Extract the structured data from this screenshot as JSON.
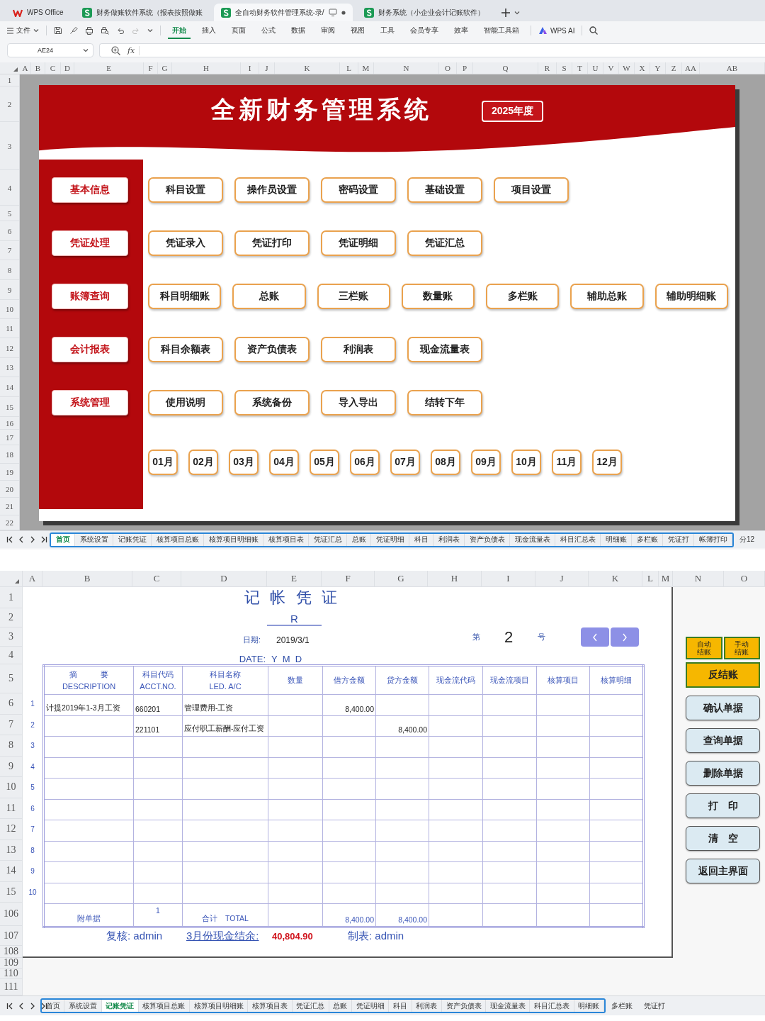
{
  "app_tabs": [
    {
      "kind": "home",
      "label": "WPS Office",
      "selected": false
    },
    {
      "kind": "sheet",
      "label": "财务做账软件系统（报表按照做账",
      "selected": false
    },
    {
      "kind": "sheet",
      "label": "全自动财务软件管理系统-录/",
      "selected": true
    },
    {
      "kind": "sheet",
      "label": "财务系统（小企业会计记账软件）",
      "selected": false
    }
  ],
  "file_menu": "文件",
  "ribbon_tabs": [
    {
      "label": "开始",
      "selected": true
    },
    {
      "label": "插入",
      "selected": false
    },
    {
      "label": "页面",
      "selected": false
    },
    {
      "label": "公式",
      "selected": false
    },
    {
      "label": "数据",
      "selected": false
    },
    {
      "label": "审阅",
      "selected": false
    },
    {
      "label": "视图",
      "selected": false
    },
    {
      "label": "工具",
      "selected": false
    },
    {
      "label": "会员专享",
      "selected": false
    },
    {
      "label": "效率",
      "selected": false
    },
    {
      "label": "智能工具箱",
      "selected": false
    }
  ],
  "ai_button": "WPS AI",
  "formula_bar": {
    "name_box": "AE24",
    "fx": "fx"
  },
  "sheet1": {
    "columns": [
      "A",
      "B",
      "C",
      "D",
      "E",
      "F",
      "G",
      "H",
      "I",
      "J",
      "K",
      "L",
      "M",
      "N",
      "O",
      "P",
      "Q",
      "R",
      "S",
      "T",
      "U",
      "V",
      "W",
      "X",
      "Y",
      "Z",
      "AA",
      "AB"
    ],
    "rows": [
      "1",
      "2",
      "3",
      "4",
      "5",
      "6",
      "7",
      "8",
      "9",
      "10",
      "11",
      "12",
      "13",
      "14",
      "15",
      "16",
      "17",
      "18",
      "19",
      "20",
      "21",
      "22"
    ],
    "dashboard": {
      "title": "全新财务管理系统",
      "year_badge": "2025年度",
      "sections": [
        {
          "category": "基本信息",
          "buttons": [
            "科目设置",
            "操作员设置",
            "密码设置",
            "基础设置",
            "项目设置"
          ]
        },
        {
          "category": "凭证处理",
          "buttons": [
            "凭证录入",
            "凭证打印",
            "凭证明细",
            "凭证汇总"
          ]
        },
        {
          "category": "账簿查询",
          "buttons": [
            "科目明细账",
            "总账",
            "三栏账",
            "数量账",
            "多栏账",
            "辅助总账",
            "辅助明细账"
          ]
        },
        {
          "category": "会计报表",
          "buttons": [
            "科目余额表",
            "资产负债表",
            "利润表",
            "现金流量表"
          ]
        },
        {
          "category": "系统管理",
          "buttons": [
            "使用说明",
            "系统备份",
            "导入导出",
            "结转下年"
          ]
        }
      ],
      "months": [
        "01月",
        "02月",
        "03月",
        "04月",
        "05月",
        "06月",
        "07月",
        "08月",
        "09月",
        "10月",
        "11月",
        "12月"
      ]
    },
    "sheet_tabs": [
      {
        "label": "首页",
        "selected": true
      },
      {
        "label": "系统设置",
        "selected": false
      },
      {
        "label": "记账凭证",
        "selected": false
      },
      {
        "label": "核算项目总账",
        "selected": false
      },
      {
        "label": "核算项目明细账",
        "selected": false
      },
      {
        "label": "核算项目表",
        "selected": false
      },
      {
        "label": "凭证汇总",
        "selected": false
      },
      {
        "label": "总账",
        "selected": false
      },
      {
        "label": "凭证明细",
        "selected": false
      },
      {
        "label": "科目",
        "selected": false
      },
      {
        "label": "利润表",
        "selected": false
      },
      {
        "label": "资产负债表",
        "selected": false
      },
      {
        "label": "现金流量表",
        "selected": false
      },
      {
        "label": "科目汇总表",
        "selected": false
      },
      {
        "label": "明细账",
        "selected": false
      },
      {
        "label": "多栏账",
        "selected": false
      },
      {
        "label": "凭证打",
        "selected": false
      },
      {
        "label": "帐簿打印",
        "selected": false
      }
    ],
    "more_tabs": [
      {
        "label": "分12",
        "selected": false
      }
    ]
  },
  "sheet2": {
    "columns": [
      "A",
      "B",
      "C",
      "D",
      "E",
      "F",
      "G",
      "H",
      "I",
      "J",
      "K",
      "L",
      "M",
      "N",
      "O"
    ],
    "rows": [
      "1",
      "2",
      "3",
      "4",
      "5",
      "6",
      "7",
      "8",
      "9",
      "10",
      "11",
      "12",
      "13",
      "14",
      "15",
      "106",
      "107",
      "108",
      "109",
      "110",
      "111"
    ],
    "voucher": {
      "title": "记 帐 凭 证",
      "subtitle": "R",
      "date_label": "日期:",
      "date": "2019/3/1",
      "date_label_en": "DATE:",
      "date_parts": "Y  M  D",
      "number_prefix": "第",
      "number": "2",
      "number_suffix": "号",
      "table": {
        "columns": [
          {
            "kind": "text",
            "label": "摘　　　要",
            "label_en": "DESCRIPTION"
          },
          {
            "kind": "code",
            "label": "科目代码",
            "label_en": "ACCT.NO."
          },
          {
            "kind": "text",
            "label": "科目名称",
            "label_en": "LED. A/C"
          },
          {
            "kind": "amount",
            "label": "数量"
          },
          {
            "kind": "amount",
            "label": "借方金额"
          },
          {
            "kind": "amount",
            "label": "贷方金额"
          },
          {
            "kind": "text",
            "label": "现金流代码"
          },
          {
            "kind": "text",
            "label": "现金流项目"
          },
          {
            "kind": "text",
            "label": "核算项目"
          },
          {
            "kind": "text",
            "label": "核算明细"
          }
        ],
        "rows": [
          {
            "line": "1",
            "cells": {
              "description": "计提2019年1-3月工资",
              "acct_no": "660201",
              "ledger": "管理费用-工资",
              "debit": "8,400.00"
            }
          },
          {
            "line": "2",
            "cells": {
              "acct_no": "221101",
              "ledger": "应付职工薪酬-应付工资",
              "credit": "8,400.00"
            }
          },
          {
            "line": "3"
          },
          {
            "line": "4"
          },
          {
            "line": "5"
          },
          {
            "line": "6"
          },
          {
            "line": "7"
          },
          {
            "line": "8"
          },
          {
            "line": "9"
          },
          {
            "line": "10"
          }
        ],
        "total": {
          "description": "附单据",
          "acct_no": "1",
          "ledger": "合计　TOTAL",
          "debit": "8,400.00",
          "credit": "8,400.00"
        }
      },
      "footer": {
        "reviewer": "复核: admin",
        "cash_label": "3月份现金结余:",
        "cash_value": "40,804.90",
        "maker": "制表: admin"
      }
    },
    "side_buttons": [
      {
        "kind": "close",
        "label": "自动结账"
      },
      {
        "kind": "close",
        "label": "手动结账"
      },
      {
        "kind": "reopen",
        "label": "反结账"
      },
      {
        "kind": "action",
        "label": "确认单据"
      },
      {
        "kind": "action",
        "label": "查询单据"
      },
      {
        "kind": "action",
        "label": "删除单据"
      },
      {
        "kind": "action",
        "label": "打　印"
      },
      {
        "kind": "action",
        "label": "清　空"
      },
      {
        "kind": "action",
        "label": "返回主界面"
      }
    ],
    "sheet_tabs": [
      {
        "label": "首页",
        "selected": false
      },
      {
        "label": "系统设置",
        "selected": false
      },
      {
        "label": "记账凭证",
        "selected": true
      },
      {
        "label": "核算项目总账",
        "selected": false
      },
      {
        "label": "核算项目明细账",
        "selected": false
      },
      {
        "label": "核算项目表",
        "selected": false
      },
      {
        "label": "凭证汇总",
        "selected": false
      },
      {
        "label": "总账",
        "selected": false
      },
      {
        "label": "凭证明细",
        "selected": false
      },
      {
        "label": "科目",
        "selected": false
      },
      {
        "label": "利润表",
        "selected": false
      },
      {
        "label": "资产负债表",
        "selected": false
      },
      {
        "label": "现金流量表",
        "selected": false
      },
      {
        "label": "科目汇总表",
        "selected": false
      },
      {
        "label": "明细账",
        "selected": false
      }
    ],
    "more_tabs": [
      {
        "label": "多栏账",
        "selected": false
      },
      {
        "label": "凭证打",
        "selected": false
      }
    ]
  }
}
